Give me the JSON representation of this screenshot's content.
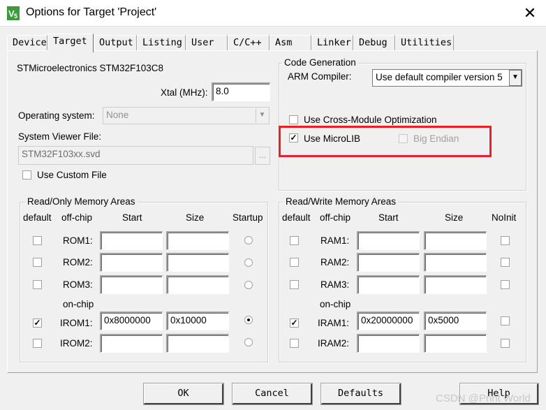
{
  "window": {
    "title": "Options for Target 'Project'",
    "close_glyph": "✕"
  },
  "tabs": [
    "Device",
    "Target",
    "Output",
    "Listing",
    "User",
    "C/C++",
    "Asm",
    "Linker",
    "Debug",
    "Utilities"
  ],
  "active_tab": "Target",
  "device": {
    "name": "STMicroelectronics STM32F103C8",
    "xtal_label": "Xtal (MHz):",
    "xtal_value": "8.0",
    "os_label": "Operating system:",
    "os_value": "None",
    "sysviewer_label": "System Viewer File:",
    "sysviewer_value": "STM32F103xx.svd",
    "browse_label": "...",
    "custom_file_label": "Use Custom File"
  },
  "code_generation": {
    "group_label": "Code Generation",
    "compiler_label": "ARM Compiler:",
    "compiler_value": "Use default compiler version 5",
    "cross_module_label": "Use Cross-Module Optimization",
    "microlib_label": "Use MicroLIB",
    "microlib_checked": true,
    "big_endian_label": "Big Endian"
  },
  "rom": {
    "group_label": "Read/Only Memory Areas",
    "headers": {
      "default": "default",
      "offchip": "off-chip",
      "start": "Start",
      "size": "Size",
      "startup": "Startup"
    },
    "onchip_label": "on-chip",
    "rows": [
      {
        "name": "ROM1:",
        "default": false,
        "start": "",
        "size": "",
        "startup": false
      },
      {
        "name": "ROM2:",
        "default": false,
        "start": "",
        "size": "",
        "startup": false
      },
      {
        "name": "ROM3:",
        "default": false,
        "start": "",
        "size": "",
        "startup": false
      },
      {
        "name": "IROM1:",
        "default": true,
        "start": "0x8000000",
        "size": "0x10000",
        "startup": true
      },
      {
        "name": "IROM2:",
        "default": false,
        "start": "",
        "size": "",
        "startup": false
      }
    ]
  },
  "ram": {
    "group_label": "Read/Write Memory Areas",
    "headers": {
      "default": "default",
      "offchip": "off-chip",
      "start": "Start",
      "size": "Size",
      "noinit": "NoInit"
    },
    "onchip_label": "on-chip",
    "rows": [
      {
        "name": "RAM1:",
        "default": false,
        "start": "",
        "size": "",
        "noinit": false
      },
      {
        "name": "RAM2:",
        "default": false,
        "start": "",
        "size": "",
        "noinit": false
      },
      {
        "name": "RAM3:",
        "default": false,
        "start": "",
        "size": "",
        "noinit": false
      },
      {
        "name": "IRAM1:",
        "default": true,
        "start": "0x20000000",
        "size": "0x5000",
        "noinit": false
      },
      {
        "name": "IRAM2:",
        "default": false,
        "start": "",
        "size": "",
        "noinit": false
      }
    ]
  },
  "buttons": {
    "ok": "OK",
    "cancel": "Cancel",
    "defaults": "Defaults",
    "help": "Help"
  },
  "watermark": "CSDN @Print World",
  "colors": {
    "highlight": "#e8202a",
    "icon_green": "#3c9a3c"
  }
}
